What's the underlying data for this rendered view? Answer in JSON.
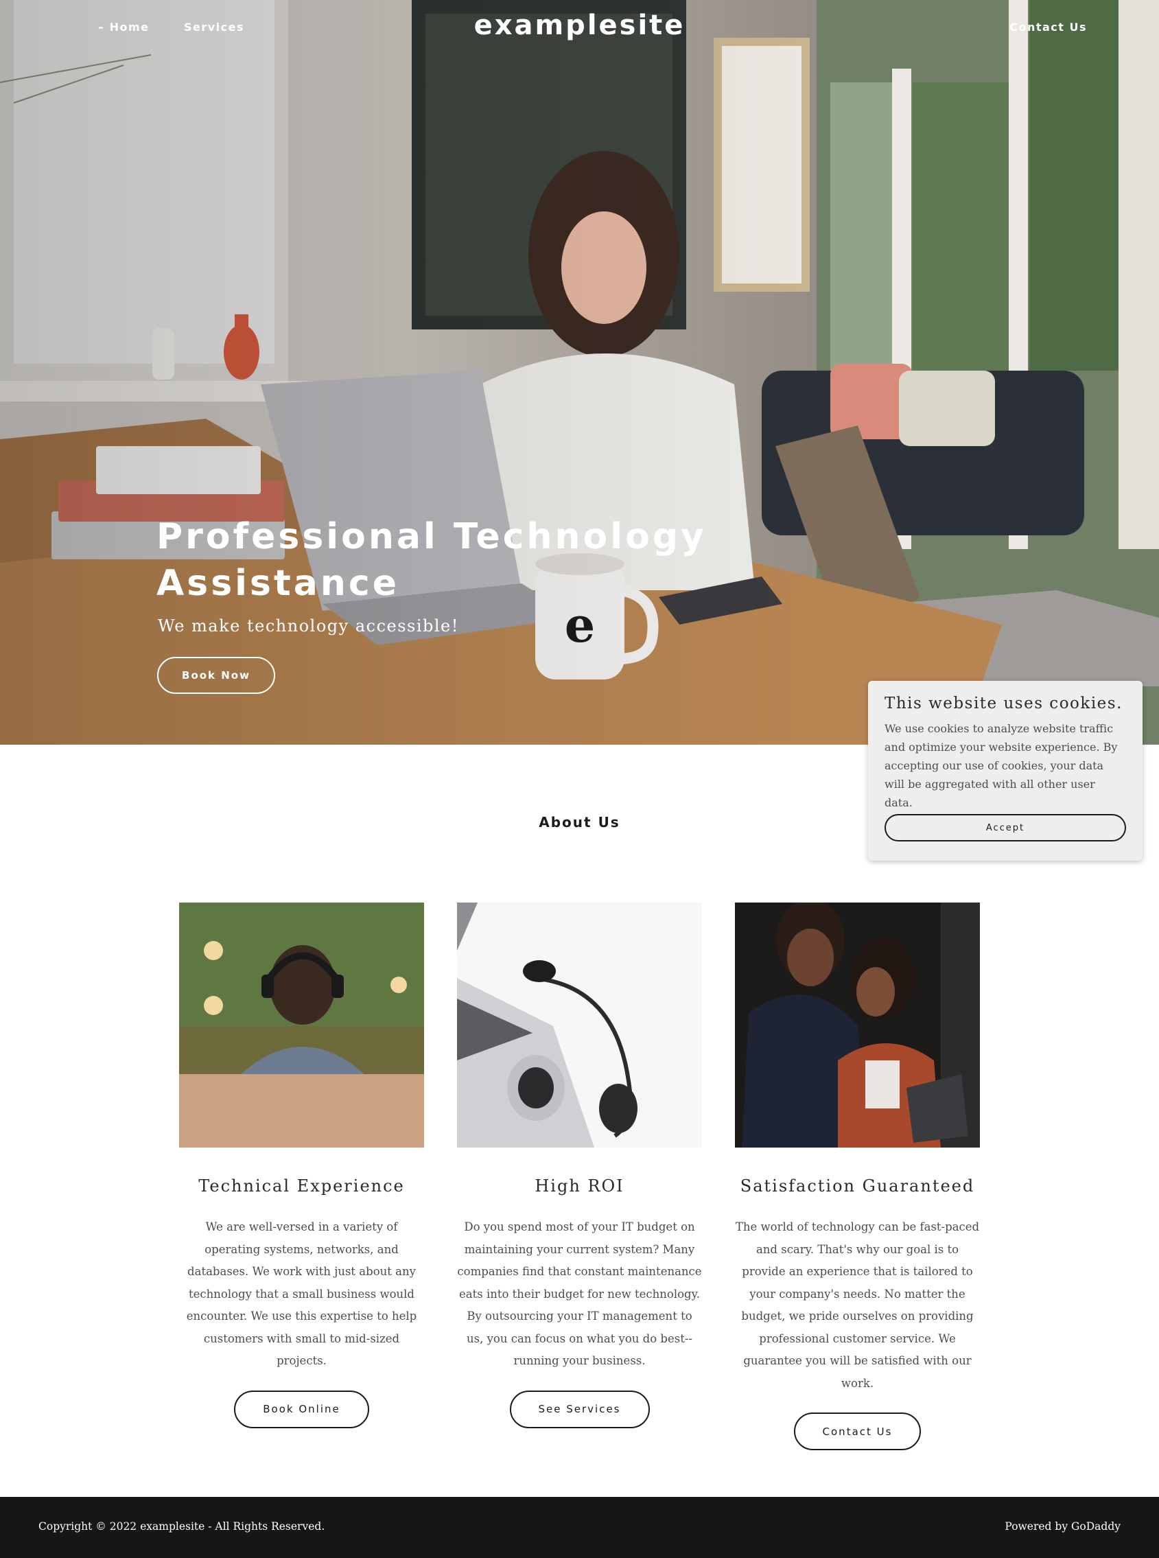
{
  "nav": {
    "home_label": "– Home",
    "services_label": "Services",
    "contact_label": "Contact Us",
    "brand": "examplesite"
  },
  "hero": {
    "title": "Professional Technology Assistance",
    "subtitle": "We make technology accessible!",
    "cta_label": "Book Now",
    "mug_letter": "e"
  },
  "cookie_banner": {
    "title": "This website uses cookies.",
    "body": "We use cookies to analyze website traffic and optimize your website experience. By accepting our use of cookies, your data will be aggregated with all other user data.",
    "accept_label": "Accept"
  },
  "about": {
    "title": "About Us",
    "cards": [
      {
        "title": "Technical Experience",
        "body": "We are well-versed in a variety of operating systems, networks, and databases. We work with just about any technology that a small business would encounter. We use this expertise to help customers with small to mid-sized projects.",
        "button_label": "Book Online"
      },
      {
        "title": "High ROI",
        "body": "Do you spend most of your IT budget on maintaining your current system? Many companies find that constant maintenance eats into their budget for new technology. By outsourcing your IT management to us, you can focus on what you do best--running your business.",
        "button_label": "See Services"
      },
      {
        "title": "Satisfaction Guaranteed",
        "body": "The world of technology can be fast-paced and scary. That's why our goal is to provide an experience that is tailored to your company's needs. No matter the budget, we pride ourselves on providing professional customer service. We guarantee you will be satisfied with our work.",
        "button_label": "Contact Us"
      }
    ]
  },
  "footer": {
    "copyright": "Copyright © 2022 examplesite - All Rights Reserved.",
    "powered_by": "Powered by GoDaddy"
  }
}
